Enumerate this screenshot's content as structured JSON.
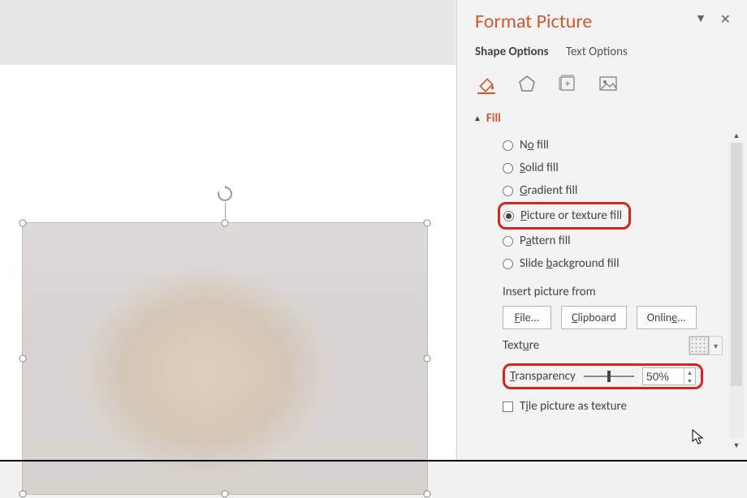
{
  "panel": {
    "title": "Format Picture",
    "tabs": {
      "shape": "Shape Options",
      "text": "Text Options"
    },
    "icons": [
      "paint-bucket-icon",
      "pentagon-icon",
      "size-icon",
      "picture-icon"
    ]
  },
  "fill": {
    "heading": "Fill",
    "options": {
      "none": {
        "label_pre": "N",
        "label_u": "o",
        "label_post": " fill"
      },
      "solid": {
        "label_pre": "",
        "label_u": "S",
        "label_post": "olid fill"
      },
      "gradient": {
        "label_pre": "",
        "label_u": "G",
        "label_post": "radient fill"
      },
      "picture": {
        "label_pre": "",
        "label_u": "P",
        "label_post": "icture or texture fill"
      },
      "pattern": {
        "label_pre": "P",
        "label_u": "a",
        "label_post": "ttern fill"
      },
      "bg": {
        "label_pre": "Slide ",
        "label_u": "b",
        "label_post": "ackground fill"
      }
    },
    "insert_label": "Insert picture from",
    "buttons": {
      "file": {
        "pre": "",
        "u": "F",
        "post": "ile..."
      },
      "clipboard": {
        "pre": "",
        "u": "C",
        "post": "lipboard"
      },
      "online": {
        "pre": "Onlin",
        "u": "e",
        "post": "..."
      }
    },
    "texture_label_pre": "Text",
    "texture_label_u": "u",
    "texture_label_post": "re",
    "transparency": {
      "pre": "",
      "u": "T",
      "post": "ransparency",
      "value": "50%",
      "slider_percent": 50
    },
    "tile": {
      "pre": "T",
      "u": "i",
      "post": "le picture as texture"
    }
  }
}
